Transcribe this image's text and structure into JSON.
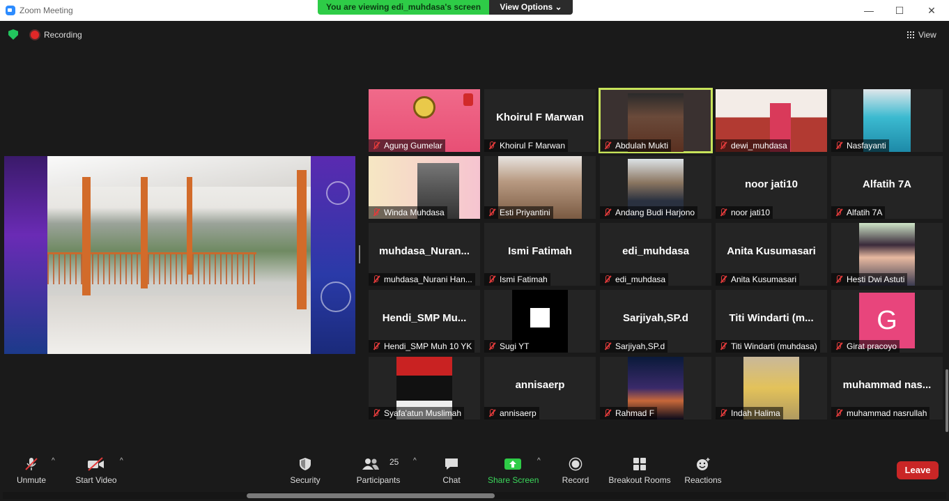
{
  "window": {
    "title": "Zoom Meeting"
  },
  "banner": {
    "viewing": "You are viewing edi_muhdasa's screen",
    "view_options": "View Options ⌄"
  },
  "topbar": {
    "recording": "Recording",
    "view": "View"
  },
  "participants": [
    {
      "name": "Agung Gumelar",
      "display": "",
      "video": true
    },
    {
      "name": "Khoirul F Marwan",
      "display": "Khoirul F Marwan",
      "video": false
    },
    {
      "name": "Abdulah Mukti",
      "display": "",
      "video": true,
      "active": true
    },
    {
      "name": "dewi_muhdasa",
      "display": "",
      "video": true
    },
    {
      "name": "Nasfayanti",
      "display": "",
      "video": true
    },
    {
      "name": "Winda Muhdasa",
      "display": "",
      "video": true
    },
    {
      "name": "Esti Priyantini",
      "display": "",
      "video": true
    },
    {
      "name": "Andang Budi Harjono",
      "display": "",
      "video": true
    },
    {
      "name": "noor jati10",
      "display": "noor jati10",
      "video": false
    },
    {
      "name": "Alfatih 7A",
      "display": "Alfatih 7A",
      "video": false
    },
    {
      "name": "muhdasa_Nurani Han...",
      "display": "muhdasa_Nuran...",
      "video": false
    },
    {
      "name": "Ismi Fatimah",
      "display": "Ismi Fatimah",
      "video": false
    },
    {
      "name": "edi_muhdasa",
      "display": "edi_muhdasa",
      "video": false
    },
    {
      "name": "Anita Kusumasari",
      "display": "Anita Kusumasari",
      "video": false
    },
    {
      "name": "Hesti Dwi Astuti",
      "display": "",
      "video": true
    },
    {
      "name": "Hendi_SMP Muh 10 YK",
      "display": "Hendi_SMP  Mu...",
      "video": false
    },
    {
      "name": "Sugi YT",
      "display": "",
      "video": true
    },
    {
      "name": "Sarjiyah,SP.d",
      "display": "Sarjiyah,SP.d",
      "video": false
    },
    {
      "name": "Titi Windarti (muhdasa)",
      "display": "Titi  Windarti  (m...",
      "video": false
    },
    {
      "name": "Girat pracoyo",
      "display": "",
      "video": true,
      "avatar": "G"
    },
    {
      "name": "Syafa'atun Muslimah",
      "display": "",
      "video": true
    },
    {
      "name": "annisaerp",
      "display": "annisaerp",
      "video": false
    },
    {
      "name": "Rahmad F",
      "display": "",
      "video": true
    },
    {
      "name": "Indah Halima",
      "display": "",
      "video": true
    },
    {
      "name": "muhammad nasrullah",
      "display": "muhammad  nas...",
      "video": false
    }
  ],
  "toolbar": {
    "unmute": "Unmute",
    "start_video": "Start Video",
    "security": "Security",
    "participants": "Participants",
    "participants_count": "25",
    "chat": "Chat",
    "share_screen": "Share Screen",
    "record": "Record",
    "breakout_rooms": "Breakout Rooms",
    "reactions": "Reactions",
    "leave": "Leave"
  },
  "colors": {
    "share_green": "#2ecc47",
    "leave_red": "#c92626",
    "active_outline": "#c7e35a",
    "avatar_pink": "#e8457c"
  }
}
